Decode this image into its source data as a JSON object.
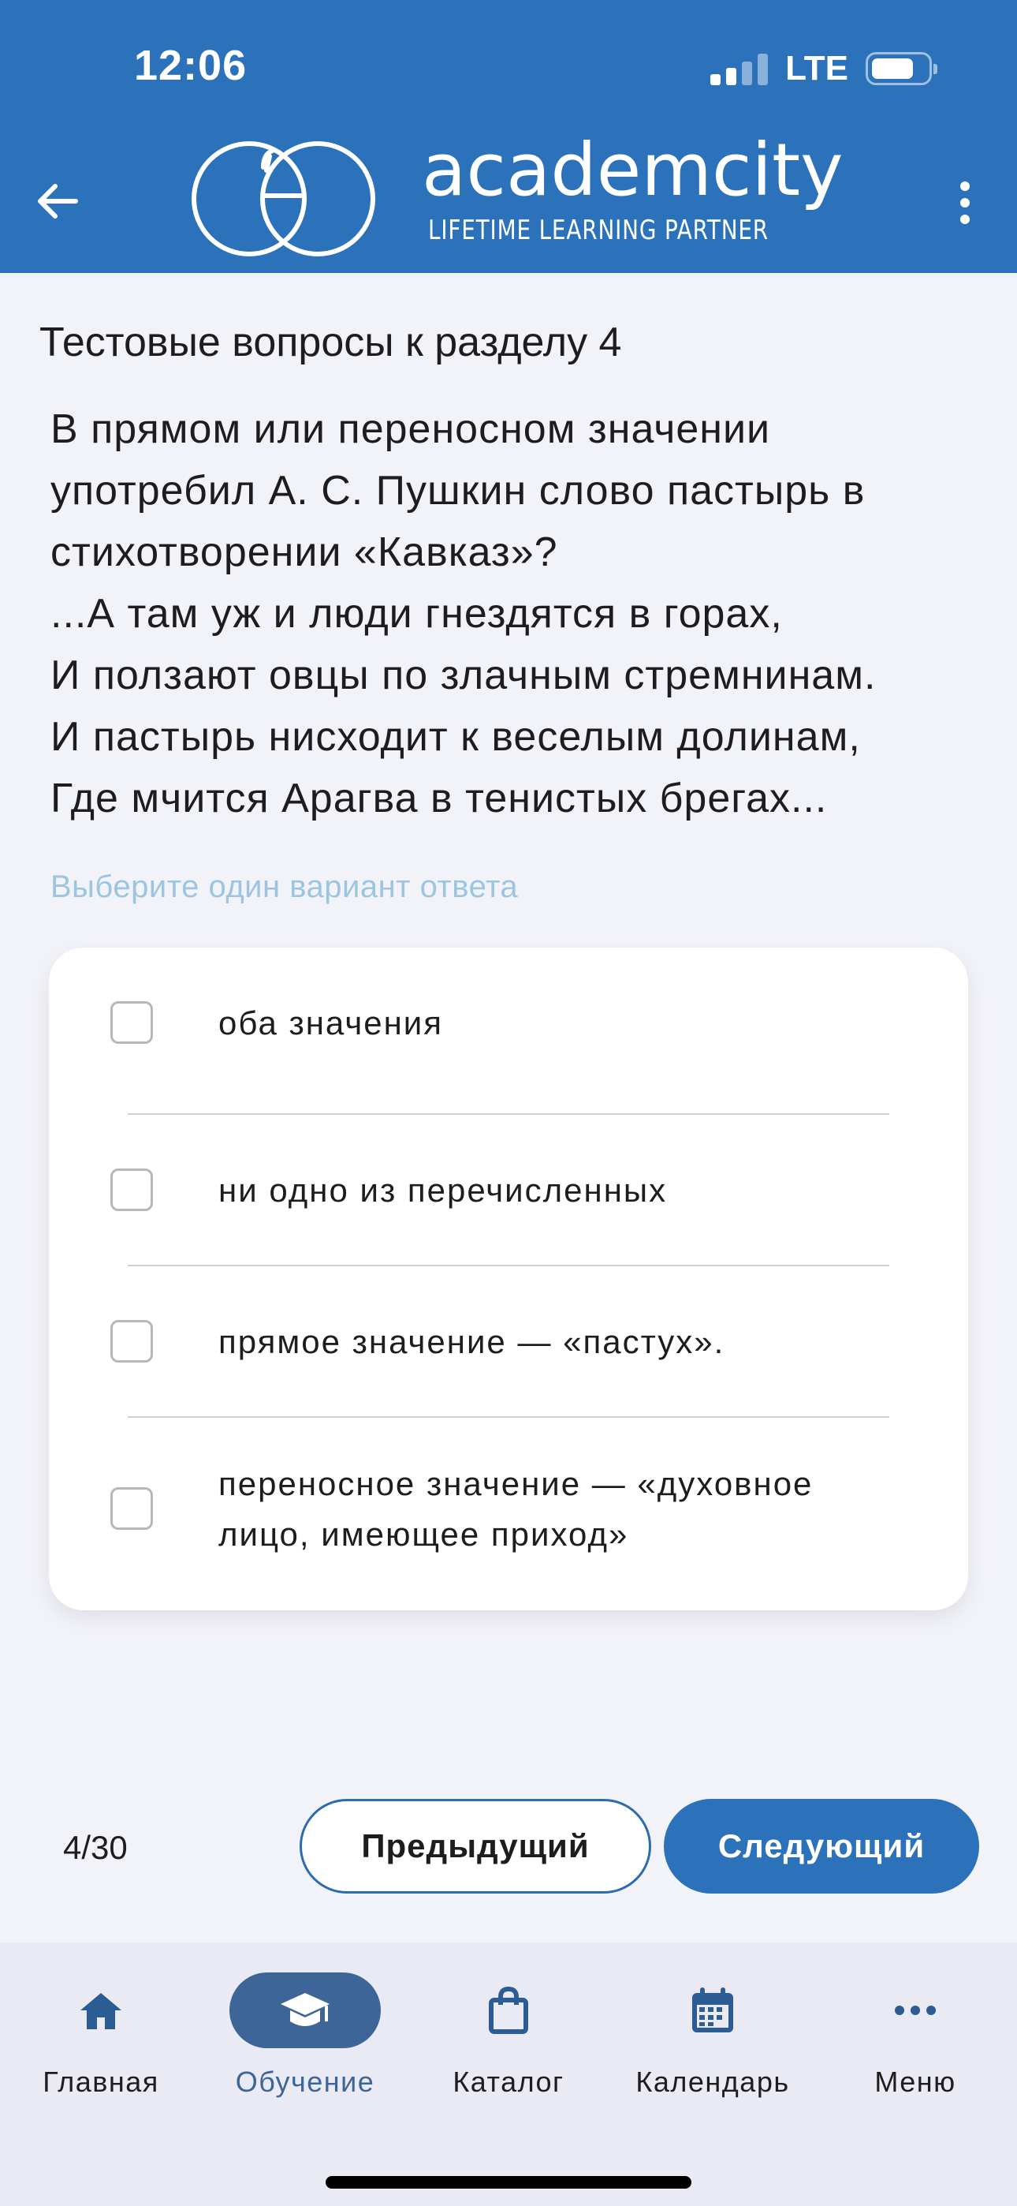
{
  "status_bar": {
    "time": "12:06",
    "network": "LTE"
  },
  "header": {
    "logo_word": "academcity",
    "logo_tagline": "LIFETIME LEARNING PARTNER",
    "back_icon": "arrow-left-icon",
    "more_icon": "more-vertical-icon",
    "background_color": "#2b72ba"
  },
  "content": {
    "section_title": "Тестовые вопросы к разделу 4",
    "question_lines": [
      "В прямом или переносном значении",
      "употребил А. С. Пушкин слово пастырь в",
      "стихотворении «Кавказ»?",
      "...А там уж и люди гнездятся в горах,",
      "И ползают овцы по злачным стремнинам.",
      "И пастырь нисходит к веселым долинам,",
      "Где мчится Арагва в тенистых брегах..."
    ],
    "hint": "Выберите один вариант ответа",
    "answers": [
      {
        "label": "оба значения",
        "checked": false
      },
      {
        "label": "ни одно из перечисленных",
        "checked": false
      },
      {
        "label": "прямое значение — «пастух».",
        "checked": false
      },
      {
        "label": "переносное значение — «духовное лицо, имеющее приход»",
        "checked": false
      }
    ]
  },
  "pager": {
    "counter": "4/30",
    "prev_label": "Предыдущий",
    "next_label": "Следующий"
  },
  "bottom_nav": {
    "items": [
      {
        "label": "Главная",
        "icon": "home-icon",
        "active": false
      },
      {
        "label": "Обучение",
        "icon": "graduation-cap-icon",
        "active": true
      },
      {
        "label": "Каталог",
        "icon": "shopping-bag-icon",
        "active": false
      },
      {
        "label": "Календарь",
        "icon": "calendar-icon",
        "active": false
      },
      {
        "label": "Меню",
        "icon": "more-horizontal-icon",
        "active": false
      }
    ],
    "active_color": "#3d6597"
  }
}
